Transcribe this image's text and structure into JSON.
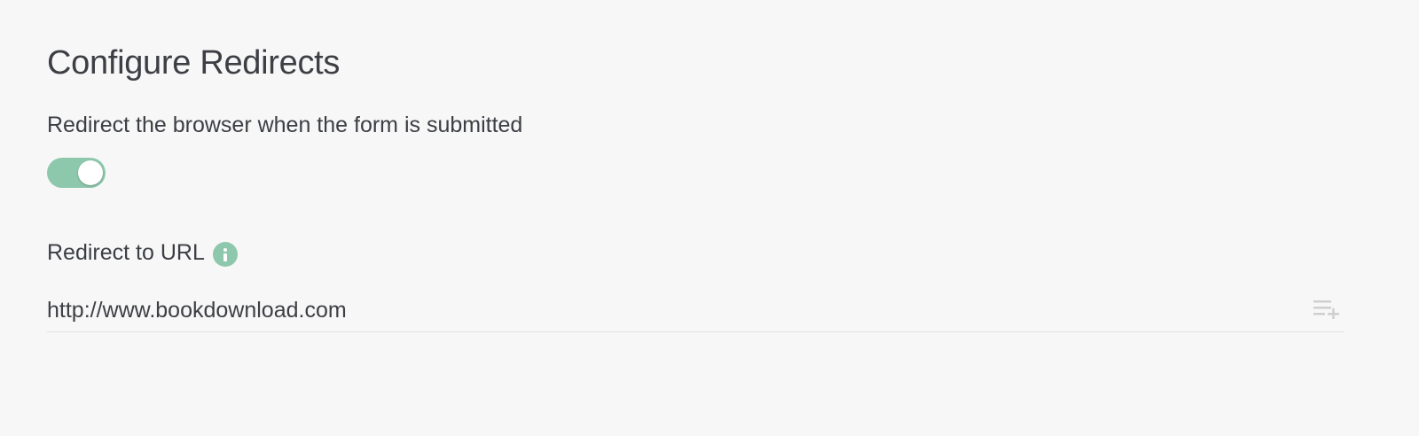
{
  "page": {
    "title": "Configure Redirects"
  },
  "redirect_toggle": {
    "label": "Redirect the browser when the form is submitted",
    "state": "on",
    "color": "#8ec8ac"
  },
  "redirect_url": {
    "label": "Redirect to URL",
    "info_icon": "info-icon",
    "value": "http://www.bookdownload.com",
    "action_icon": "insert-variable-icon"
  }
}
